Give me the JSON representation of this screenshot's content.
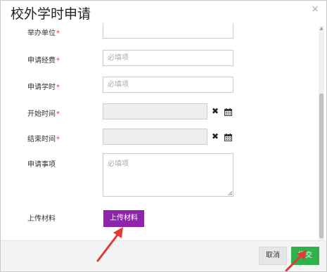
{
  "dialog": {
    "title": "校外学时申请",
    "close_symbol": "×"
  },
  "form": {
    "organizer": {
      "label": "举办单位",
      "required": "*"
    },
    "cost": {
      "label": "申请经费",
      "required": "*",
      "placeholder": "必填项"
    },
    "hours": {
      "label": "申请学时",
      "required": "*",
      "placeholder": "必填项"
    },
    "start_time": {
      "label": "开始时间",
      "required": "*",
      "clear_symbol": "✖"
    },
    "end_time": {
      "label": "结束时间",
      "required": "*",
      "clear_symbol": "✖"
    },
    "matter": {
      "label": "申请事项",
      "placeholder": "必填项"
    },
    "materials": {
      "label": "上传材料",
      "button_label": "上传材料"
    }
  },
  "footer": {
    "cancel_label": "取消",
    "submit_label": "提交"
  },
  "colors": {
    "upload_button": "#8e24aa",
    "submit_button": "#2fb24a",
    "annotation_arrow": "#e53935"
  }
}
